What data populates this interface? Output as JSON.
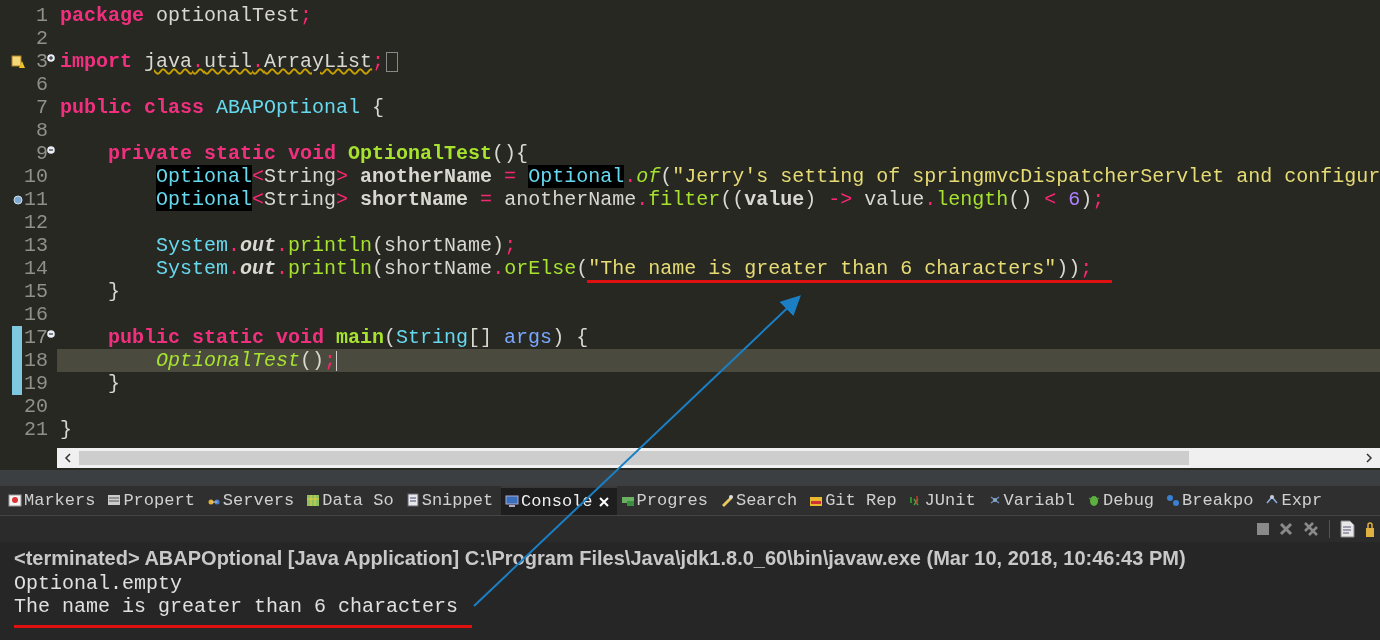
{
  "editor": {
    "lines": [
      {
        "number": "1",
        "changed": false,
        "current": false,
        "tokens": [
          {
            "kind": "kw",
            "text": "package"
          },
          {
            "kind": "txt",
            "text": " optionalTest"
          },
          {
            "kind": "op",
            "text": ";"
          }
        ]
      },
      {
        "number": "2",
        "changed": false,
        "current": false
      },
      {
        "number": "3",
        "changed": false,
        "current": false,
        "fold": {
          "expanded": false
        },
        "marker": {
          "kind": "warning"
        },
        "tokens": [
          {
            "kind": "kw",
            "text": "import "
          },
          {
            "kind": "warn",
            "text": "java"
          },
          {
            "kind": "warnop",
            "text": "."
          },
          {
            "kind": "warn",
            "text": "util"
          },
          {
            "kind": "warnop",
            "text": "."
          },
          {
            "kind": "warn",
            "text": "ArrayList"
          },
          {
            "kind": "op",
            "text": ";"
          }
        ]
      },
      {
        "number": "6",
        "changed": false,
        "current": false
      },
      {
        "number": "7",
        "changed": false,
        "current": false,
        "tokens": [
          {
            "kind": "kw",
            "text": "public class "
          },
          {
            "kind": "type",
            "text": "ABAPOptional"
          },
          {
            "kind": "txt",
            "text": " {"
          }
        ]
      },
      {
        "number": "8",
        "changed": false,
        "current": false
      },
      {
        "number": "9",
        "changed": false,
        "current": false,
        "fold": {
          "expanded": true
        },
        "tokens": [
          {
            "kind": "kw",
            "text": "    private static void "
          },
          {
            "kind": "fnb",
            "text": "OptionalTest"
          },
          {
            "kind": "txt",
            "text": "(){"
          }
        ]
      },
      {
        "number": "10",
        "changed": false,
        "current": false,
        "tokens": [
          {
            "kind": "typehl",
            "text": "        Optional"
          },
          {
            "kind": "op",
            "text": "<"
          },
          {
            "kind": "txt",
            "text": "String"
          },
          {
            "kind": "op",
            "text": ">"
          },
          {
            "kind": "bold",
            "text": " anotherName "
          },
          {
            "kind": "op",
            "text": "= "
          },
          {
            "kind": "typehl",
            "text": "Optional"
          },
          {
            "kind": "op",
            "text": "."
          },
          {
            "kind": "fni",
            "text": "of"
          },
          {
            "kind": "txt",
            "text": "("
          },
          {
            "kind": "str",
            "text": "\"Jerry's setting of springmvcDispatcherServlet and configur"
          }
        ]
      },
      {
        "number": "11",
        "changed": false,
        "current": false,
        "marker": {
          "kind": "breakpoint"
        },
        "tokens": [
          {
            "kind": "typehl",
            "text": "        Optional"
          },
          {
            "kind": "op",
            "text": "<"
          },
          {
            "kind": "txt",
            "text": "String"
          },
          {
            "kind": "op",
            "text": ">"
          },
          {
            "kind": "bold",
            "text": " shortName "
          },
          {
            "kind": "op",
            "text": "="
          },
          {
            "kind": "txt",
            "text": " anotherName"
          },
          {
            "kind": "op",
            "text": "."
          },
          {
            "kind": "fn",
            "text": "filter"
          },
          {
            "kind": "txt",
            "text": "(("
          },
          {
            "kind": "bold",
            "text": "value"
          },
          {
            "kind": "txt",
            "text": ") "
          },
          {
            "kind": "op",
            "text": "->"
          },
          {
            "kind": "txt",
            "text": " value"
          },
          {
            "kind": "op",
            "text": "."
          },
          {
            "kind": "fn",
            "text": "length"
          },
          {
            "kind": "txt",
            "text": "() "
          },
          {
            "kind": "op",
            "text": "< "
          },
          {
            "kind": "num",
            "text": "6"
          },
          {
            "kind": "txt",
            "text": ")"
          },
          {
            "kind": "op",
            "text": ";"
          }
        ]
      },
      {
        "number": "12",
        "changed": false,
        "current": false
      },
      {
        "number": "13",
        "changed": false,
        "current": false,
        "tokens": [
          {
            "kind": "type",
            "text": "        System"
          },
          {
            "kind": "op",
            "text": "."
          },
          {
            "kind": "field",
            "text": "out"
          },
          {
            "kind": "op",
            "text": "."
          },
          {
            "kind": "fn",
            "text": "println"
          },
          {
            "kind": "txt",
            "text": "(shortName)"
          },
          {
            "kind": "op",
            "text": ";"
          }
        ]
      },
      {
        "number": "14",
        "changed": false,
        "current": false,
        "tokens": [
          {
            "kind": "type",
            "text": "        System"
          },
          {
            "kind": "op",
            "text": "."
          },
          {
            "kind": "field",
            "text": "out"
          },
          {
            "kind": "op",
            "text": "."
          },
          {
            "kind": "fn",
            "text": "println"
          },
          {
            "kind": "txt",
            "text": "(shortName"
          },
          {
            "kind": "op",
            "text": "."
          },
          {
            "kind": "fn",
            "text": "orElse"
          },
          {
            "kind": "txt",
            "text": "("
          },
          {
            "kind": "str",
            "text": "\"The name is greater than 6 characters\""
          },
          {
            "kind": "txt",
            "text": "))"
          },
          {
            "kind": "op",
            "text": ";"
          }
        ]
      },
      {
        "number": "15",
        "changed": false,
        "current": false,
        "tokens": [
          {
            "kind": "txt",
            "text": "    }"
          }
        ]
      },
      {
        "number": "16",
        "changed": false,
        "current": false
      },
      {
        "number": "17",
        "changed": true,
        "current": false,
        "fold": {
          "expanded": true
        },
        "tokens": [
          {
            "kind": "kw",
            "text": "    public static void "
          },
          {
            "kind": "fnb",
            "text": "main"
          },
          {
            "kind": "txt",
            "text": "("
          },
          {
            "kind": "type",
            "text": "String"
          },
          {
            "kind": "txt",
            "text": "[] "
          },
          {
            "kind": "param",
            "text": "args"
          },
          {
            "kind": "txt",
            "text": ") {"
          }
        ]
      },
      {
        "number": "18",
        "changed": true,
        "current": true,
        "tokens": [
          {
            "kind": "fni",
            "text": "        OptionalTest"
          },
          {
            "kind": "txt",
            "text": "()"
          },
          {
            "kind": "op",
            "text": ";"
          }
        ]
      },
      {
        "number": "19",
        "changed": true,
        "current": false,
        "tokens": [
          {
            "kind": "txt",
            "text": "    }"
          }
        ]
      },
      {
        "number": "20",
        "changed": false,
        "current": false
      },
      {
        "number": "21",
        "changed": false,
        "current": false,
        "tokens": [
          {
            "kind": "txt",
            "text": "}"
          }
        ]
      }
    ]
  },
  "views": {
    "tabs": [
      {
        "label": "Markers",
        "selected": false
      },
      {
        "label": "Propert",
        "selected": false
      },
      {
        "label": "Servers",
        "selected": false
      },
      {
        "label": "Data So",
        "selected": false
      },
      {
        "label": "Snippet",
        "selected": false
      },
      {
        "label": "Console",
        "selected": true
      },
      {
        "label": "Progres",
        "selected": false
      },
      {
        "label": "Search",
        "selected": false
      },
      {
        "label": "Git Rep",
        "selected": false
      },
      {
        "label": "JUnit",
        "selected": false
      },
      {
        "label": "Variabl",
        "selected": false
      },
      {
        "label": "Debug",
        "selected": false
      },
      {
        "label": "Breakpo",
        "selected": false
      },
      {
        "label": "Expr",
        "selected": false
      }
    ]
  },
  "console": {
    "header": "<terminated> ABAPOptional [Java Application] C:\\Program Files\\Java\\jdk1.8.0_60\\bin\\javaw.exe (Mar 10, 2018, 10:46:43 PM)",
    "output": [
      "Optional.empty",
      "The name is greater than 6 characters"
    ]
  }
}
